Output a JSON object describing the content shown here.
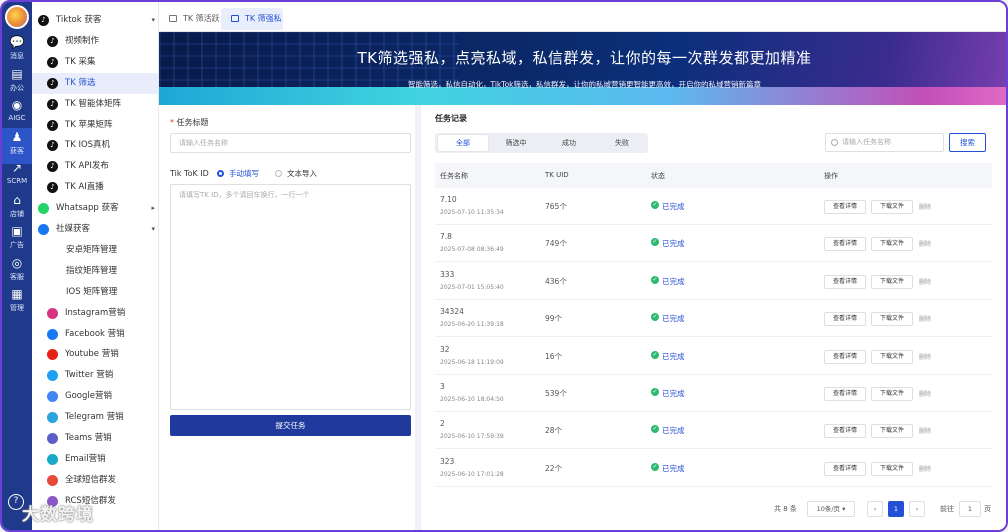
{
  "rail": [
    {
      "label": "消息",
      "icon": "chat-icon"
    },
    {
      "label": "办公",
      "icon": "briefcase-icon"
    },
    {
      "label": "AIGC",
      "icon": "aigc-icon"
    },
    {
      "label": "获客",
      "icon": "users-icon",
      "active": true
    },
    {
      "label": "SCRM",
      "icon": "chart-icon"
    },
    {
      "label": "店铺",
      "icon": "store-icon"
    },
    {
      "label": "广告",
      "icon": "ads-icon"
    },
    {
      "label": "客服",
      "icon": "headset-icon"
    },
    {
      "label": "管理",
      "icon": "grid-icon"
    }
  ],
  "sidebar": {
    "items": [
      {
        "label": "Tiktok 获客",
        "level": 0,
        "icon": "tiktok-icon",
        "arrow": "▾"
      },
      {
        "label": "视频制作",
        "level": 1,
        "icon": "tiktok-icon"
      },
      {
        "label": "TK 采集",
        "level": 1,
        "icon": "tiktok-icon"
      },
      {
        "label": "TK 筛选",
        "level": 1,
        "icon": "tiktok-icon",
        "active": true
      },
      {
        "label": "TK 智能体矩阵",
        "level": 1,
        "icon": "tiktok-icon"
      },
      {
        "label": "TK 苹果矩阵",
        "level": 1,
        "icon": "tiktok-icon"
      },
      {
        "label": "TK IOS真机",
        "level": 1,
        "icon": "tiktok-icon"
      },
      {
        "label": "TK API发布",
        "level": 1,
        "icon": "tiktok-icon"
      },
      {
        "label": "TK AI直播",
        "level": 1,
        "icon": "tiktok-icon"
      },
      {
        "label": "Whatsapp 获客",
        "level": 0,
        "icon": "whatsapp-icon",
        "arrow": "▸"
      },
      {
        "label": "社媒获客",
        "level": 0,
        "icon": "facebook-icon",
        "arrow": "▾"
      },
      {
        "label": "安卓矩阵管理",
        "level": 2
      },
      {
        "label": "指纹矩阵管理",
        "level": 2
      },
      {
        "label": "IOS 矩阵管理",
        "level": 2
      },
      {
        "label": "Instagram营销",
        "level": 1,
        "icon": "instagram-icon"
      },
      {
        "label": "Facebook 营销",
        "level": 1,
        "icon": "facebook-icon"
      },
      {
        "label": "Youtube 营销",
        "level": 1,
        "icon": "youtube-icon"
      },
      {
        "label": "Twitter 营销",
        "level": 1,
        "icon": "twitter-icon"
      },
      {
        "label": "Google营销",
        "level": 1,
        "icon": "google-icon"
      },
      {
        "label": "Telegram 营销",
        "level": 1,
        "icon": "telegram-icon"
      },
      {
        "label": "Teams 营销",
        "level": 1,
        "icon": "teams-icon"
      },
      {
        "label": "Email营销",
        "level": 1,
        "icon": "email-icon"
      },
      {
        "label": "全球短信群发",
        "level": 1,
        "icon": "sms-icon"
      },
      {
        "label": "RCS短信群发",
        "level": 1,
        "icon": "rcs-icon"
      }
    ]
  },
  "watermark": "大数跨境",
  "tabs": [
    {
      "label": "TK 筛活跃"
    },
    {
      "label": "TK 筛强私",
      "active": true
    }
  ],
  "banner": {
    "title": "TK筛选强私，点亮私域，私信群发，让你的每一次群发都更加精准",
    "subtitle": "智能筛选，私信自动化，TikTok筛选，私信群发，让你的私域营销更智能更高效，开启你的私域营销新篇章"
  },
  "form": {
    "task_label": "任务标题",
    "task_placeholder": "请输入任务名称",
    "tiktok_id_label": "Tik ToK ID",
    "radio_manual": "手动填写",
    "radio_import": "文本导入",
    "textarea_placeholder": "请填写TK ID，多个请回车换行，一行一个",
    "submit": "提交任务"
  },
  "records": {
    "title": "任务记录",
    "filters": [
      "全部",
      "筛选中",
      "成功",
      "失败"
    ],
    "search_placeholder": "请输入任务名称",
    "search_button": "搜索",
    "columns": [
      "任务名称",
      "TK UID",
      "状态",
      "操作"
    ],
    "view_label": "查看详情",
    "download_label": "下载文件",
    "delete_label": "删除",
    "rows": [
      {
        "name": "7.10",
        "date": "2025-07-10 11:35:34",
        "uid": "765个",
        "status": "已完成"
      },
      {
        "name": "7.8",
        "date": "2025-07-08 08:36:49",
        "uid": "749个",
        "status": "已完成"
      },
      {
        "name": "333",
        "date": "2025-07-01 15:05:40",
        "uid": "436个",
        "status": "已完成"
      },
      {
        "name": "34324",
        "date": "2025-06-20 11:39:18",
        "uid": "99个",
        "status": "已完成"
      },
      {
        "name": "32",
        "date": "2025-06-18 11:19:09",
        "uid": "16个",
        "status": "已完成"
      },
      {
        "name": "3",
        "date": "2025-06-10 18:04:50",
        "uid": "539个",
        "status": "已完成"
      },
      {
        "name": "2",
        "date": "2025-06-10 17:59:39",
        "uid": "28个",
        "status": "已完成"
      },
      {
        "name": "323",
        "date": "2025-06-10 17:01:28",
        "uid": "22个",
        "status": "已完成"
      }
    ],
    "pager": {
      "total": "共 8 条",
      "per_page": "10条/页",
      "prev": "‹",
      "current": "1",
      "next": "›",
      "goto": "前往",
      "goto_value": "1",
      "page_suffix": "页"
    }
  },
  "colors": {
    "primary": "#2450d6",
    "rail": "#1f3a8a",
    "submit": "#1f3a9c",
    "success": "#2eb872"
  }
}
